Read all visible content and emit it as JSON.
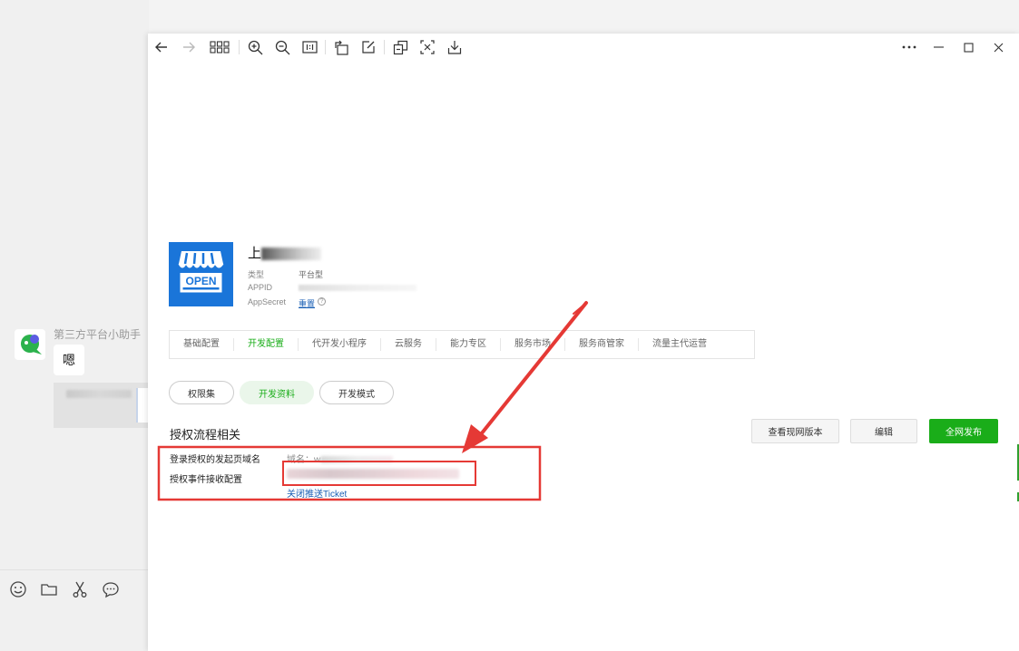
{
  "chat": {
    "sender": "第三方平台小助手",
    "message": "嗯"
  },
  "icons": {
    "chat_tools": [
      "emoji-icon",
      "folder-icon",
      "scissors-icon",
      "chat-bubble-icon"
    ],
    "toolbar": [
      "back-arrow-icon",
      "forward-arrow-icon",
      "grid-icon",
      "zoom-in-icon",
      "zoom-out-icon",
      "actual-size-icon",
      "rotate-icon",
      "edit-icon",
      "copy-icon",
      "text-recognize-icon",
      "download-icon"
    ],
    "window": [
      "more-icon",
      "minimize-icon",
      "maximize-icon",
      "close-icon"
    ]
  },
  "platform": {
    "logo_text": "OPEN",
    "name_prefix": "上",
    "type_label": "类型",
    "type_value": "平台型",
    "appid_label": "APPID",
    "secret_label": "AppSecret",
    "secret_action": "重置",
    "help_glyph": "?"
  },
  "main_tabs": [
    {
      "label": "基础配置",
      "active": false
    },
    {
      "label": "开发配置",
      "active": true
    },
    {
      "label": "代开发小程序",
      "active": false
    },
    {
      "label": "云服务",
      "active": false
    },
    {
      "label": "能力专区",
      "active": false
    },
    {
      "label": "服务市场",
      "active": false
    },
    {
      "label": "服务商管家",
      "active": false
    },
    {
      "label": "流量主代运营",
      "active": false
    }
  ],
  "pills": [
    {
      "label": "权限集",
      "active": false
    },
    {
      "label": "开发资料",
      "active": true
    },
    {
      "label": "开发模式",
      "active": false
    }
  ],
  "section": {
    "title": "授权流程相关",
    "btn_view": "查看现网版本",
    "btn_edit": "编辑",
    "btn_publish": "全网发布"
  },
  "config": {
    "domain_label": "登录授权的发起页域名",
    "domain_value_prefix": "域名：w",
    "event_label": "授权事件接收配置",
    "ticket_link": "关闭推送Ticket"
  },
  "colors": {
    "accent_green": "#1aad19",
    "link_blue": "#1a5fb4",
    "annotation_red": "#e53935",
    "logo_blue": "#1a75d9"
  }
}
